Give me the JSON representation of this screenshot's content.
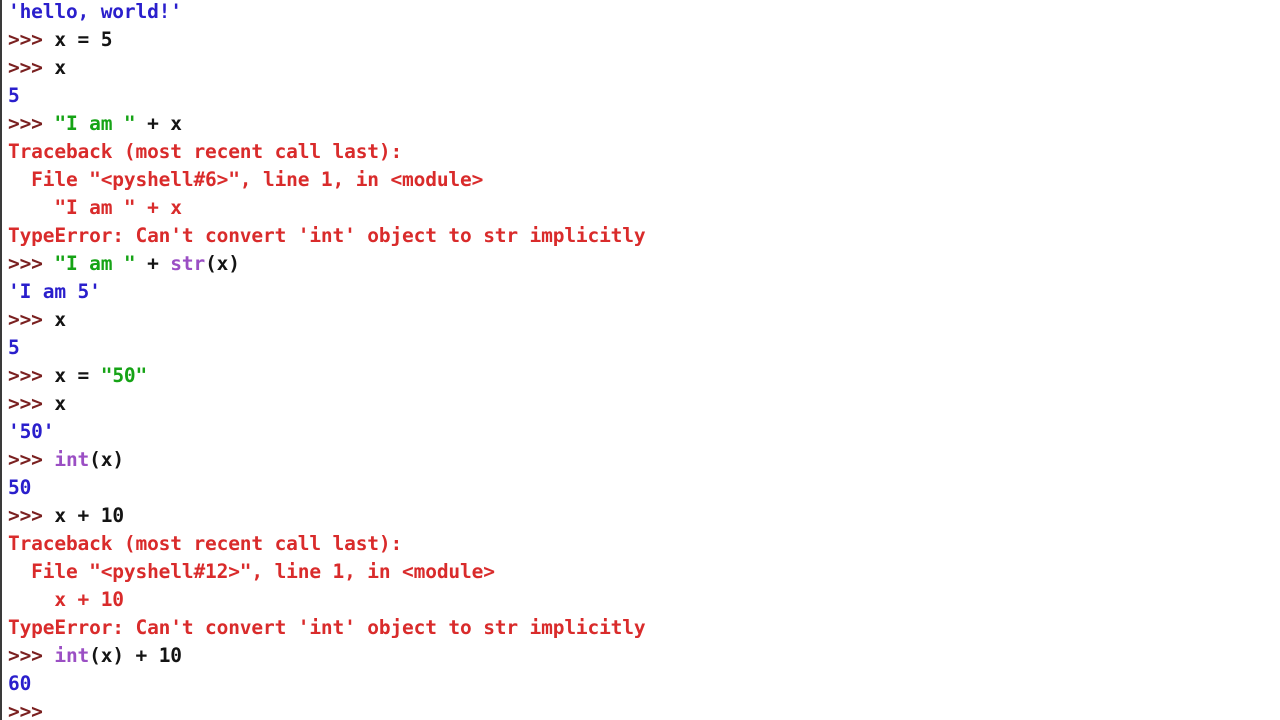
{
  "app": {
    "name": "Python IDLE Shell",
    "background_color": "#ffffff"
  },
  "colors": {
    "prompt": "#7a2020",
    "code": "#141414",
    "string": "#16a316",
    "builtin": "#9b4fc4",
    "output": "#2a1fcc",
    "error": "#d92b2b"
  },
  "console": {
    "prompt_symbol": ">>> ",
    "lines": [
      {
        "kind": "output",
        "tokens": [
          {
            "t": "'hello, world!'",
            "c": "output"
          }
        ]
      },
      {
        "kind": "input",
        "tokens": [
          {
            "t": ">>> ",
            "c": "prompt"
          },
          {
            "t": "x = 5",
            "c": "code"
          }
        ]
      },
      {
        "kind": "input",
        "tokens": [
          {
            "t": ">>> ",
            "c": "prompt"
          },
          {
            "t": "x",
            "c": "code"
          }
        ]
      },
      {
        "kind": "output",
        "tokens": [
          {
            "t": "5",
            "c": "output"
          }
        ]
      },
      {
        "kind": "input",
        "tokens": [
          {
            "t": ">>> ",
            "c": "prompt"
          },
          {
            "t": "\"I am \"",
            "c": "string"
          },
          {
            "t": " + x",
            "c": "code"
          }
        ]
      },
      {
        "kind": "error",
        "tokens": [
          {
            "t": "Traceback (most recent call last):",
            "c": "error"
          }
        ]
      },
      {
        "kind": "error",
        "tokens": [
          {
            "t": "  File \"<pyshell#6>\", line 1, in <module>",
            "c": "error"
          }
        ]
      },
      {
        "kind": "error",
        "tokens": [
          {
            "t": "    \"I am \" + x",
            "c": "error"
          }
        ]
      },
      {
        "kind": "error",
        "tokens": [
          {
            "t": "TypeError: Can't convert 'int' object to str implicitly",
            "c": "error"
          }
        ]
      },
      {
        "kind": "input",
        "tokens": [
          {
            "t": ">>> ",
            "c": "prompt"
          },
          {
            "t": "\"I am \"",
            "c": "string"
          },
          {
            "t": " + ",
            "c": "code"
          },
          {
            "t": "str",
            "c": "builtin"
          },
          {
            "t": "(x)",
            "c": "code"
          }
        ]
      },
      {
        "kind": "output",
        "tokens": [
          {
            "t": "'I am 5'",
            "c": "output"
          }
        ]
      },
      {
        "kind": "input",
        "tokens": [
          {
            "t": ">>> ",
            "c": "prompt"
          },
          {
            "t": "x",
            "c": "code"
          }
        ]
      },
      {
        "kind": "output",
        "tokens": [
          {
            "t": "5",
            "c": "output"
          }
        ]
      },
      {
        "kind": "input",
        "tokens": [
          {
            "t": ">>> ",
            "c": "prompt"
          },
          {
            "t": "x = ",
            "c": "code"
          },
          {
            "t": "\"50\"",
            "c": "string"
          }
        ]
      },
      {
        "kind": "input",
        "tokens": [
          {
            "t": ">>> ",
            "c": "prompt"
          },
          {
            "t": "x",
            "c": "code"
          }
        ]
      },
      {
        "kind": "output",
        "tokens": [
          {
            "t": "'50'",
            "c": "output"
          }
        ]
      },
      {
        "kind": "input",
        "tokens": [
          {
            "t": ">>> ",
            "c": "prompt"
          },
          {
            "t": "int",
            "c": "builtin"
          },
          {
            "t": "(x)",
            "c": "code"
          }
        ]
      },
      {
        "kind": "output",
        "tokens": [
          {
            "t": "50",
            "c": "output"
          }
        ]
      },
      {
        "kind": "input",
        "tokens": [
          {
            "t": ">>> ",
            "c": "prompt"
          },
          {
            "t": "x + 10",
            "c": "code"
          }
        ]
      },
      {
        "kind": "error",
        "tokens": [
          {
            "t": "Traceback (most recent call last):",
            "c": "error"
          }
        ]
      },
      {
        "kind": "error",
        "tokens": [
          {
            "t": "  File \"<pyshell#12>\", line 1, in <module>",
            "c": "error"
          }
        ]
      },
      {
        "kind": "error",
        "tokens": [
          {
            "t": "    x + 10",
            "c": "error"
          }
        ]
      },
      {
        "kind": "error",
        "tokens": [
          {
            "t": "TypeError: Can't convert 'int' object to str implicitly",
            "c": "error"
          }
        ]
      },
      {
        "kind": "input",
        "tokens": [
          {
            "t": ">>> ",
            "c": "prompt"
          },
          {
            "t": "int",
            "c": "builtin"
          },
          {
            "t": "(x) + 10",
            "c": "code"
          }
        ]
      },
      {
        "kind": "output",
        "tokens": [
          {
            "t": "60",
            "c": "output"
          }
        ]
      },
      {
        "kind": "input",
        "tokens": [
          {
            "t": ">>>",
            "c": "prompt"
          }
        ]
      }
    ]
  }
}
